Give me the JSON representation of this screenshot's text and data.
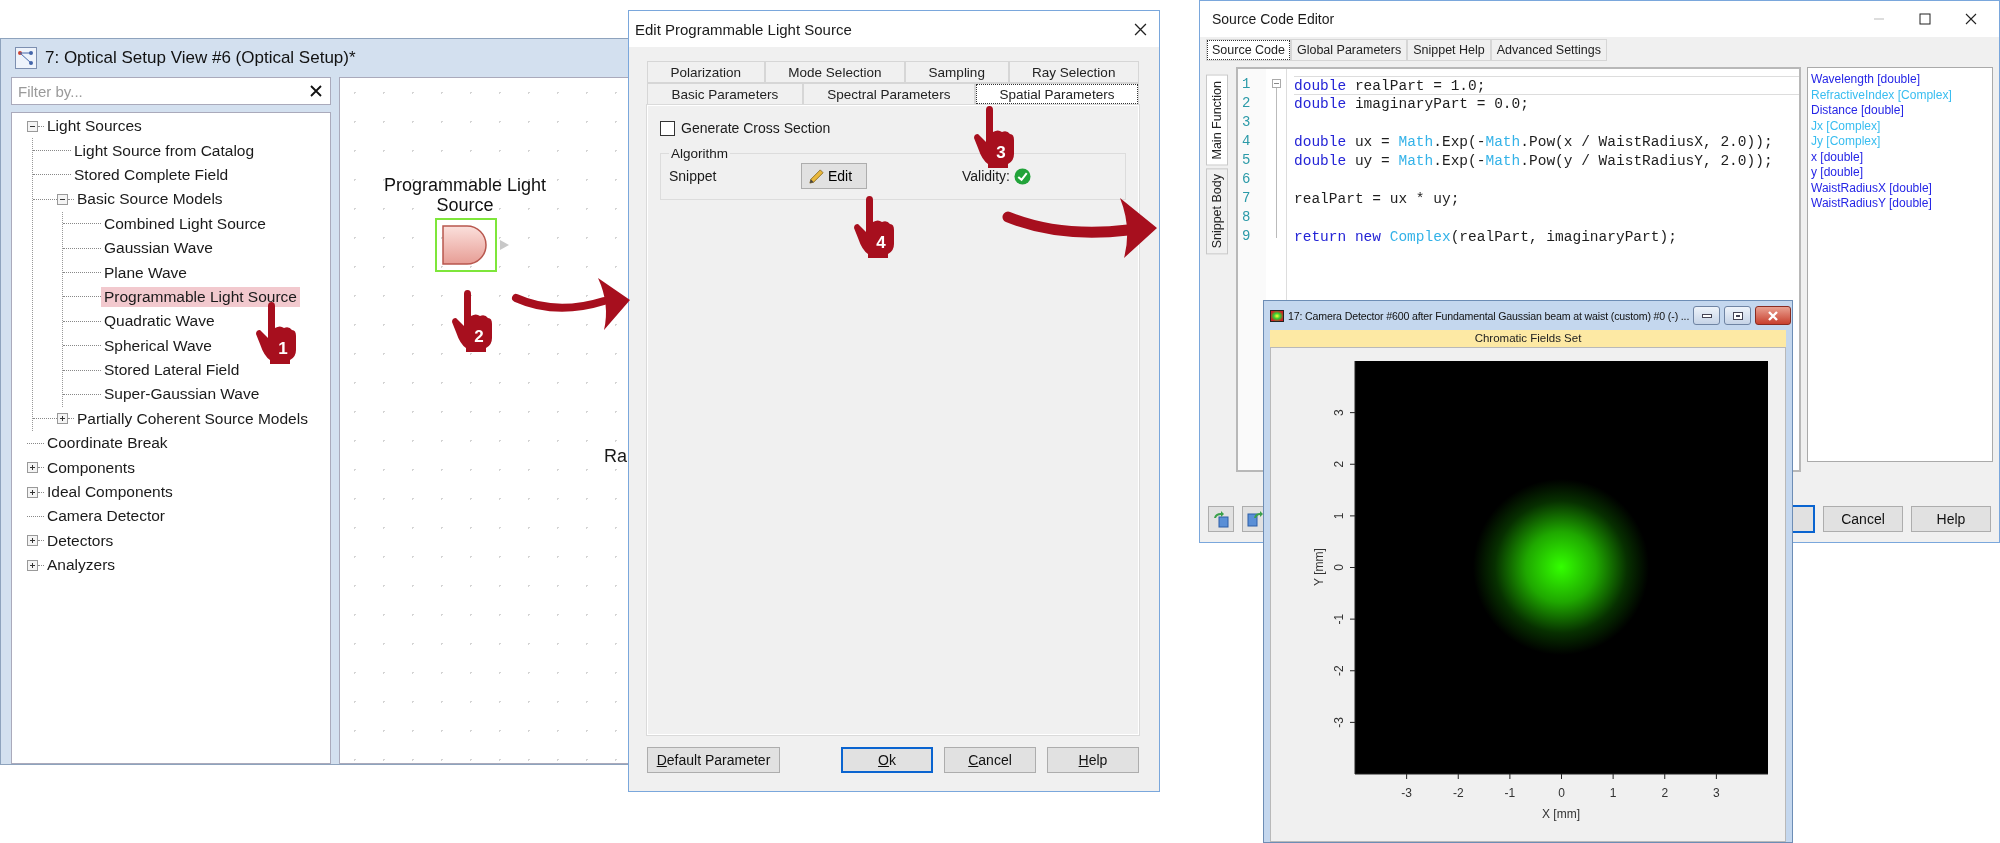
{
  "setup_window": {
    "title": "7: Optical Setup View #6 (Optical Setup)*",
    "filter": {
      "placeholder": "Filter by..."
    },
    "tree": [
      {
        "label": "Light Sources",
        "expanded": true,
        "selected": false,
        "children": [
          {
            "label": "Light Source from Catalog",
            "selected": false
          },
          {
            "label": "Stored Complete Field",
            "selected": false
          },
          {
            "label": "Basic Source Models",
            "expanded": true,
            "selected": false,
            "children": [
              {
                "label": "Combined Light Source",
                "selected": false
              },
              {
                "label": "Gaussian Wave",
                "selected": false
              },
              {
                "label": "Plane Wave",
                "selected": false
              },
              {
                "label": "Programmable Light Source",
                "selected": true
              },
              {
                "label": "Quadratic Wave",
                "selected": false
              },
              {
                "label": "Spherical Wave",
                "selected": false
              },
              {
                "label": "Stored Lateral Field",
                "selected": false
              },
              {
                "label": "Super-Gaussian Wave",
                "selected": false
              }
            ]
          },
          {
            "label": "Partially Coherent Source Models",
            "expanded": false,
            "selected": false
          }
        ]
      },
      {
        "label": "Coordinate Break",
        "selected": false
      },
      {
        "label": "Components",
        "expanded": false,
        "selected": false
      },
      {
        "label": "Ideal Components",
        "expanded": false,
        "selected": false
      },
      {
        "label": "Camera Detector",
        "selected": false
      },
      {
        "label": "Detectors",
        "expanded": false,
        "selected": false
      },
      {
        "label": "Analyzers",
        "expanded": false,
        "selected": false
      }
    ],
    "canvas": {
      "node_label": "Programmable Light Source",
      "node_selected": true,
      "partial_label": "Ra"
    }
  },
  "dialog": {
    "title": "Edit Programmable Light Source",
    "tab_rows": [
      [
        {
          "label": "Polarization",
          "selected": false
        },
        {
          "label": "Mode Selection",
          "selected": false
        },
        {
          "label": "Sampling",
          "selected": false
        },
        {
          "label": "Ray Selection",
          "selected": false
        }
      ],
      [
        {
          "label": "Basic Parameters",
          "selected": false
        },
        {
          "label": "Spectral Parameters",
          "selected": false
        },
        {
          "label": "Spatial Parameters",
          "selected": true
        }
      ]
    ],
    "cross_section": {
      "label": "Generate Cross Section",
      "checked": false
    },
    "algorithm": {
      "title": "Algorithm",
      "label": "Snippet",
      "edit_button": "Edit",
      "validity_label": "Validity:",
      "valid": true
    },
    "buttons": [
      {
        "label": "Default Parameter",
        "kind": "left",
        "default": false,
        "underline_first": true
      },
      {
        "label": "Ok",
        "kind": "right",
        "default": true,
        "underline_first": true
      },
      {
        "label": "Cancel",
        "kind": "right",
        "default": false,
        "underline_first": true
      },
      {
        "label": "Help",
        "kind": "right",
        "default": false,
        "underline_first": true
      }
    ]
  },
  "editor": {
    "title": "Source Code Editor",
    "tabs": [
      {
        "label": "Source Code",
        "selected": true
      },
      {
        "label": "Global Parameters",
        "selected": false
      },
      {
        "label": "Snippet Help",
        "selected": false
      },
      {
        "label": "Advanced Settings",
        "selected": false
      }
    ],
    "side_tabs": [
      {
        "label": "Main Function",
        "selected": true
      },
      {
        "label": "Snippet Body",
        "selected": false
      }
    ],
    "code": [
      {
        "number": "1",
        "current": true,
        "tokens": [
          {
            "text": "double",
            "kind": "keyword"
          },
          {
            "text": " realPart = 1.0;",
            "kind": "plain"
          }
        ]
      },
      {
        "number": "2",
        "current": false,
        "tokens": [
          {
            "text": "double",
            "kind": "keyword"
          },
          {
            "text": " imaginaryPart = 0.0;",
            "kind": "plain"
          }
        ]
      },
      {
        "number": "3",
        "current": false
      },
      {
        "number": "4",
        "current": false,
        "tokens": [
          {
            "text": "double",
            "kind": "keyword"
          },
          {
            "text": " ux = ",
            "kind": "plain"
          },
          {
            "text": "Math",
            "kind": "type"
          },
          {
            "text": ".Exp(-",
            "kind": "plain"
          },
          {
            "text": "Math",
            "kind": "type"
          },
          {
            "text": ".Pow(x / WaistRadiusX, 2.0));",
            "kind": "plain"
          }
        ]
      },
      {
        "number": "5",
        "current": false,
        "tokens": [
          {
            "text": "double",
            "kind": "keyword"
          },
          {
            "text": " uy = ",
            "kind": "plain"
          },
          {
            "text": "Math",
            "kind": "type"
          },
          {
            "text": ".Exp(-",
            "kind": "plain"
          },
          {
            "text": "Math",
            "kind": "type"
          },
          {
            "text": ".Pow(y / WaistRadiusY, 2.0));",
            "kind": "plain"
          }
        ]
      },
      {
        "number": "6",
        "current": false
      },
      {
        "number": "7",
        "current": false,
        "tokens": [
          {
            "text": "realPart = ux * uy;",
            "kind": "plain"
          }
        ]
      },
      {
        "number": "8",
        "current": false
      },
      {
        "number": "9",
        "current": false,
        "tokens": [
          {
            "text": "return",
            "kind": "keyword"
          },
          {
            "text": "new",
            "kind": "keyword",
            "gap": true
          },
          {
            "text": "Complex",
            "kind": "type",
            "gap": true
          },
          {
            "text": "(realPart, imaginaryPart);",
            "kind": "plain"
          }
        ]
      }
    ],
    "parameters": [
      {
        "text": "Wavelength [double]",
        "color": "#2626e6"
      },
      {
        "text": "RefractiveIndex [Complex]",
        "color": "#38bdf0"
      },
      {
        "text": "Distance [double]",
        "color": "#2626e6"
      },
      {
        "text": "Jx [Complex]",
        "color": "#38bdf0"
      },
      {
        "text": "Jy [Complex]",
        "color": "#38bdf0"
      },
      {
        "text": "x [double]",
        "color": "#2626e6"
      },
      {
        "text": "y [double]",
        "color": "#2626e6"
      },
      {
        "text": "WaistRadiusX [double]",
        "color": "#2626e6"
      },
      {
        "text": "WaistRadiusY [double]",
        "color": "#2626e6"
      }
    ],
    "buttons": [
      {
        "label": "Cancel"
      },
      {
        "label": "Help"
      }
    ]
  },
  "camera_window": {
    "title": "17: Camera Detector #600 after Fundamental Gaussian beam at waist (custom) #0 (-) ...",
    "header": "Chromatic Fields Set",
    "plot": {
      "xlabel": "X [mm]",
      "ylabel": "Y [mm]",
      "xticks": [
        "-3",
        "-2",
        "-1",
        "0",
        "1",
        "2",
        "3"
      ],
      "yticks": [
        "-3",
        "-2",
        "-1",
        "0",
        "1",
        "2",
        "3"
      ]
    }
  },
  "callouts": [
    {
      "number": "1"
    },
    {
      "number": "2"
    },
    {
      "number": "3"
    },
    {
      "number": "4"
    }
  ]
}
